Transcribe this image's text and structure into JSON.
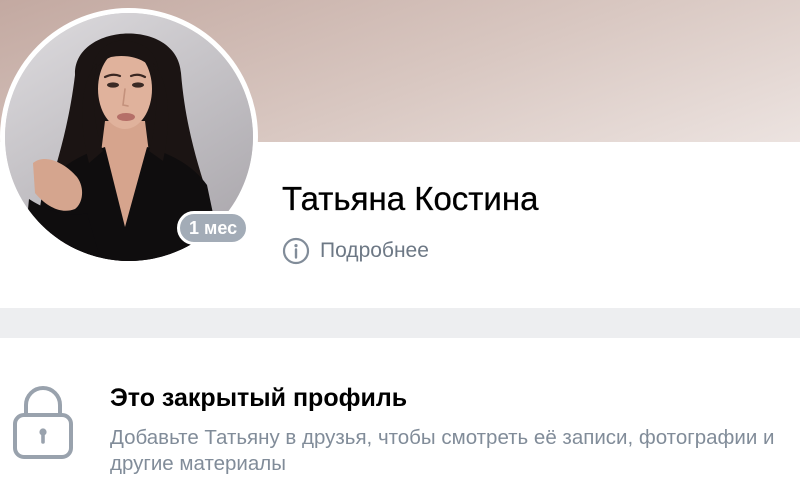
{
  "profile": {
    "name": "Татьяна Костина",
    "last_seen_badge": "1 мес",
    "details_label": "Подробнее",
    "details_icon": "info-icon"
  },
  "private_profile": {
    "icon": "lock-icon",
    "title": "Это закрытый профиль",
    "description": "Добавьте Татьяну в друзья, чтобы смотреть её записи, фотографии и другие материалы"
  },
  "colors": {
    "cover_start": "#c3a9a1",
    "cover_mid": "#d9c8c2",
    "cover_end": "#ece3e0",
    "badge": "#a3acb7",
    "muted_text": "#818c99",
    "secondary_text": "#6d7885",
    "separator": "#edeef0",
    "icon": "#99a2ad"
  }
}
